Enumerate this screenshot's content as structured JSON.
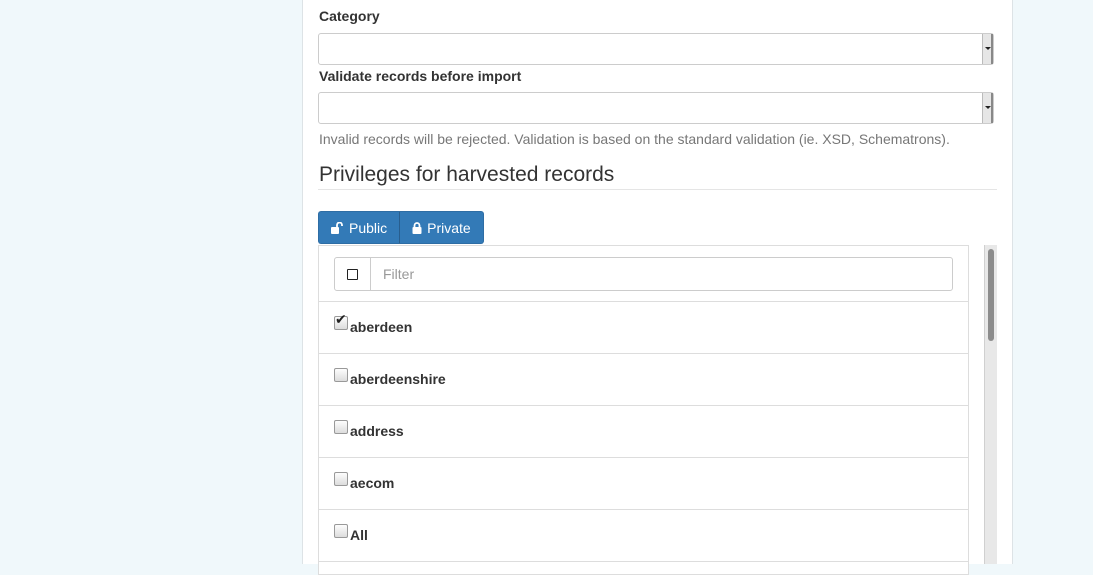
{
  "form": {
    "category_label": "Category",
    "category_value": "",
    "validate_label": "Validate records before import",
    "validate_value": "",
    "validate_help": "Invalid records will be rejected. Validation is based on the standard validation (ie. XSD, Schematrons)."
  },
  "privileges": {
    "heading": "Privileges for harvested records",
    "public_label": "Public",
    "private_label": "Private",
    "filter_placeholder": "Filter",
    "groups": [
      {
        "name": "aberdeen",
        "checked": true
      },
      {
        "name": "aberdeenshire",
        "checked": false
      },
      {
        "name": "address",
        "checked": false
      },
      {
        "name": "aecom",
        "checked": false
      },
      {
        "name": "All",
        "checked": false
      }
    ]
  },
  "icons": {
    "public": "unlock-icon",
    "private": "lock-icon",
    "select_all": "checkbox-icon",
    "checked": "checkmark-icon"
  },
  "colors": {
    "primary_button": "#337ab7",
    "page_background": "#f0f8fb"
  }
}
